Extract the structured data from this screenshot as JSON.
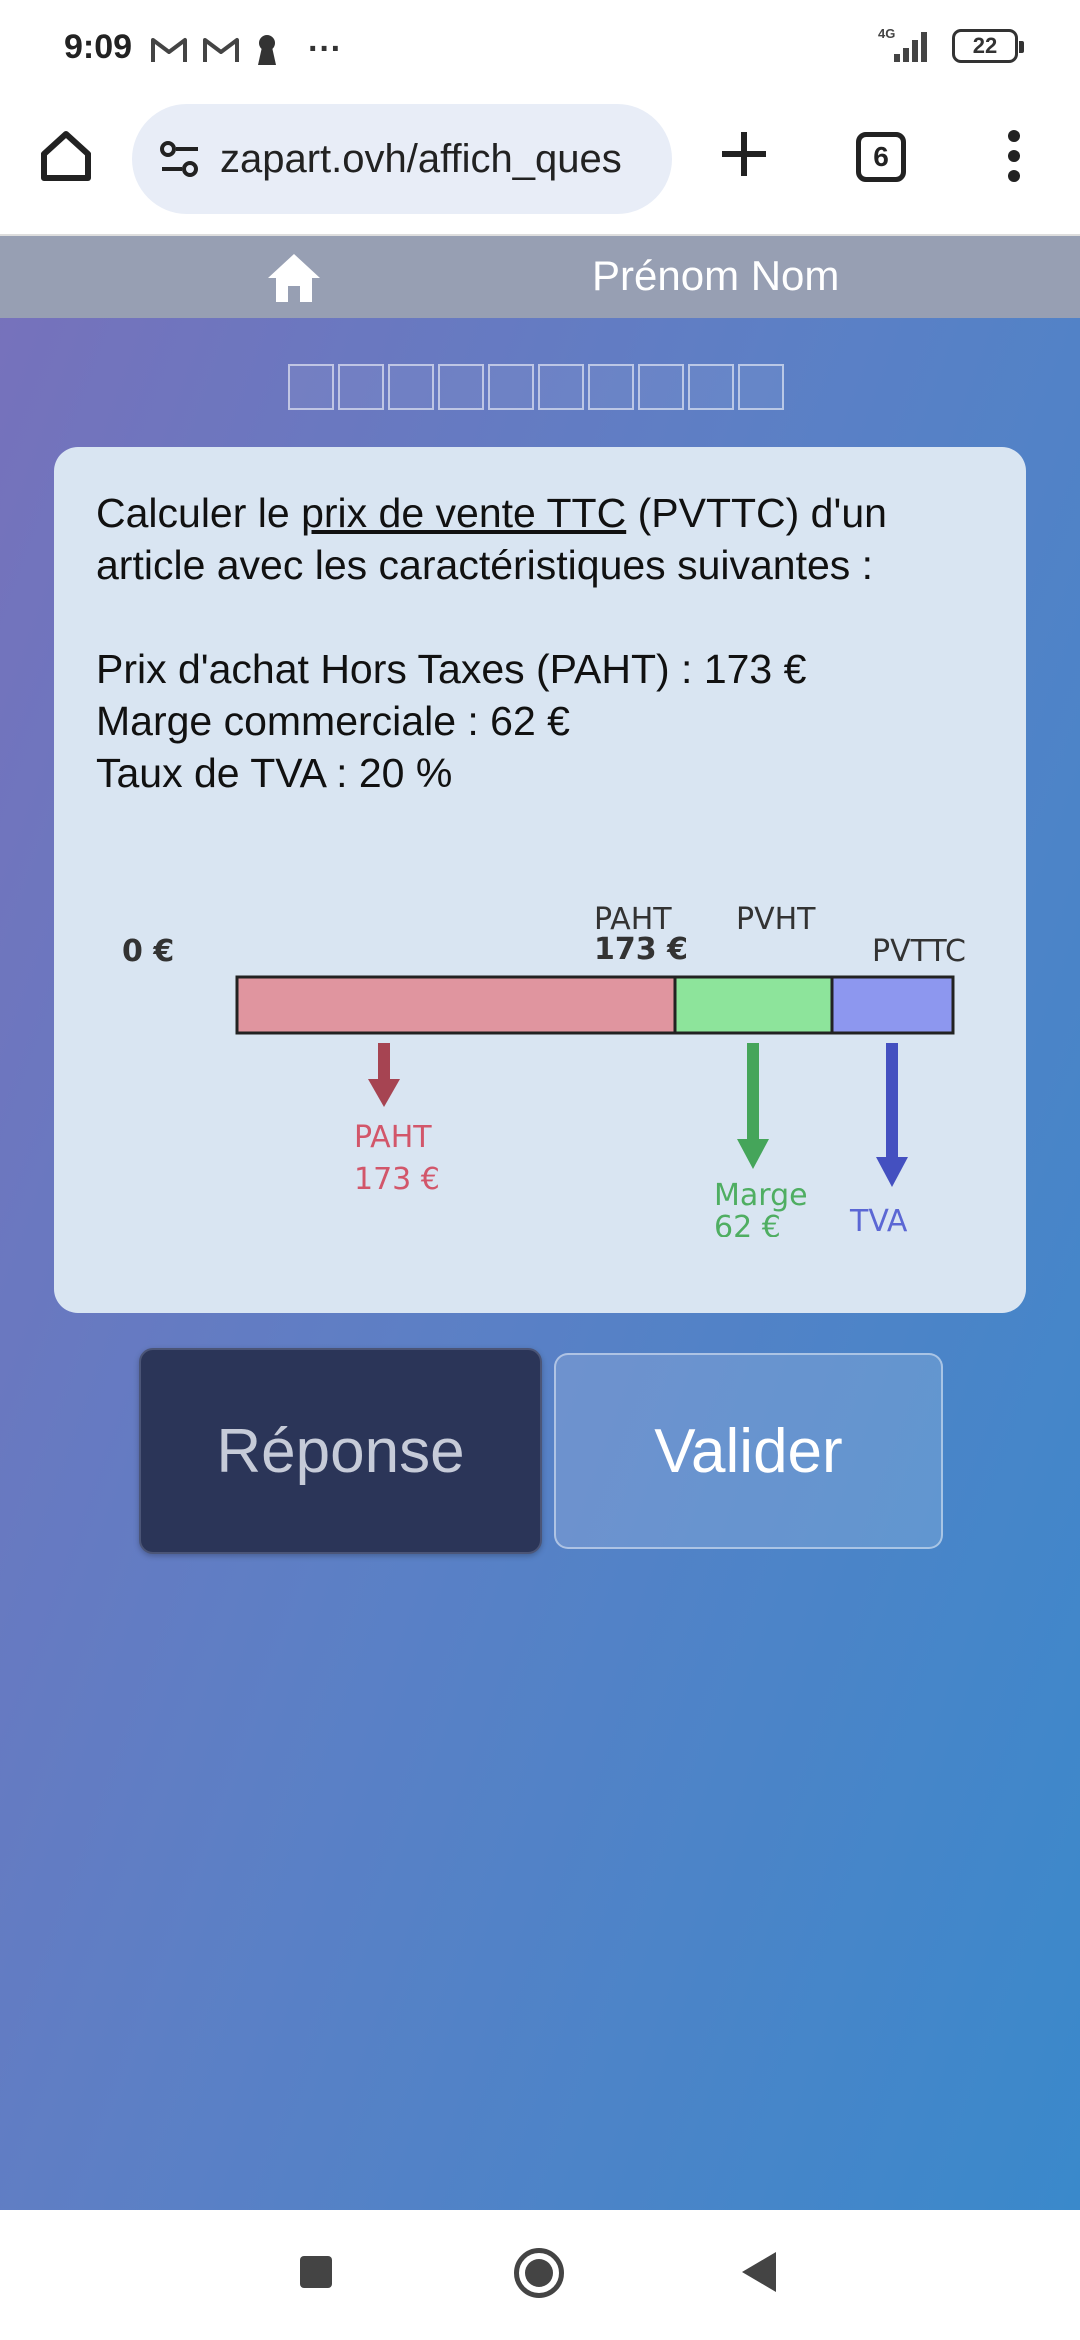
{
  "status_bar": {
    "time": "9:09",
    "network": "4G",
    "battery": "22",
    "overflow": "···"
  },
  "browser": {
    "url": "zapart.ovh/affich_ques",
    "tab_count": "6"
  },
  "nav": {
    "user_name": "Prénom Nom"
  },
  "progress": {
    "total": 10,
    "completed": 0
  },
  "question": {
    "intro_before": "Calculer le ",
    "intro_link": "prix de vente TTC",
    "intro_after": " (PVTTC) d'un article avec les caractéristiques suivantes :",
    "line1": "Prix d'achat Hors Taxes (PAHT) : 173 €",
    "line2": "Marge commerciale : 62 €",
    "line3": "Taux de TVA : 20 %"
  },
  "diagram": {
    "start_label": "0 €",
    "paht_top_label": "PAHT",
    "paht_top_value": "173 €",
    "pvht_label": "PVHT",
    "pvttc_label": "PVTTC",
    "paht_label": "PAHT",
    "paht_value": "173 €",
    "marge_label": "Marge",
    "marge_value": "62 €",
    "tva_label": "TVA",
    "colors": {
      "paht": "#e0959f",
      "marge": "#8de49b",
      "tva": "#8d97ef",
      "paht_arrow": "#a64452",
      "marge_arrow": "#45a55a",
      "tva_arrow": "#4450c0",
      "paht_text": "#d2566a",
      "marge_text": "#4fae62",
      "tva_text": "#5b67d4"
    }
  },
  "buttons": {
    "reponse": "Réponse",
    "valider": "Valider"
  }
}
